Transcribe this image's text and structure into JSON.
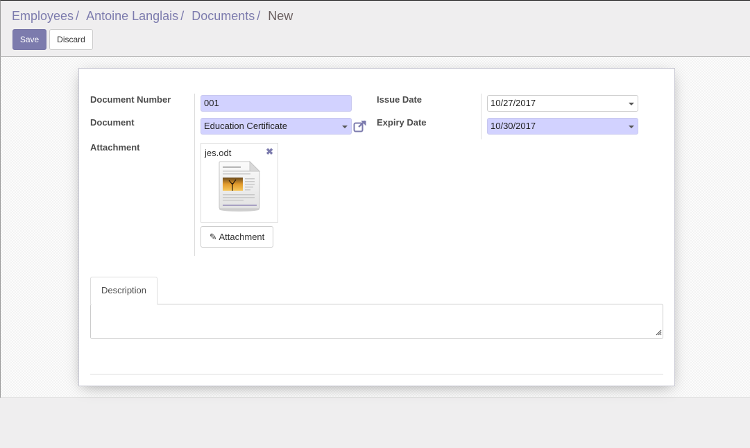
{
  "breadcrumb": {
    "items": [
      "Employees",
      "Antoine Langlais",
      "Documents"
    ],
    "separator": "/",
    "current": "New"
  },
  "toolbar": {
    "save_label": "Save",
    "discard_label": "Discard"
  },
  "form": {
    "document_number": {
      "label": "Document Number",
      "value": "001"
    },
    "document": {
      "label": "Document",
      "value": "Education Certificate",
      "external_link_icon": "external-link-icon"
    },
    "attachment": {
      "label": "Attachment",
      "file_name": "jes.odt",
      "remove_icon": "close-icon",
      "file_icon": "document-file-icon",
      "button_label": "Attachment",
      "button_icon": "paperclip-icon"
    },
    "issue_date": {
      "label": "Issue Date",
      "value": "10/27/2017"
    },
    "expiry_date": {
      "label": "Expiry Date",
      "value": "10/30/2017"
    }
  },
  "tabs": [
    {
      "label": "Description",
      "active": true
    }
  ],
  "description": {
    "value": ""
  },
  "colors": {
    "brand": "#7c7bad",
    "required_field": "#d2d2ff",
    "background": "#efeeef"
  }
}
